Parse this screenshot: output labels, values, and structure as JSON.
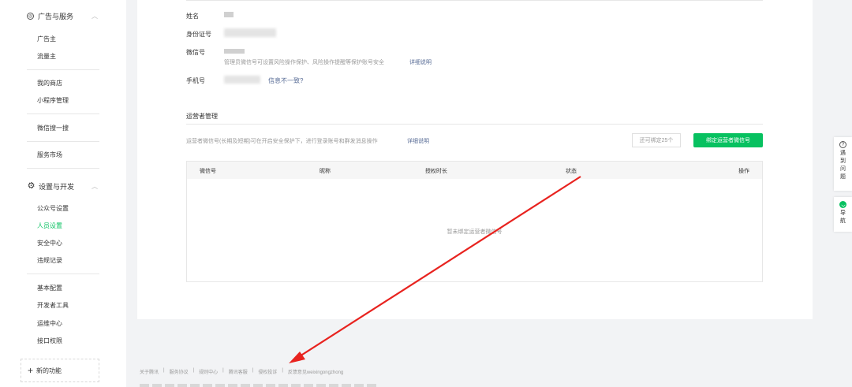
{
  "sidebar": {
    "ads_section": "广告与服务",
    "ads_items": [
      "广告主",
      "流量主"
    ],
    "shop_items": [
      "我的商店",
      "小程序管理"
    ],
    "search_item": "微信搜一搜",
    "market_item": "服务市场",
    "settings_section": "设置与开发",
    "settings_items": [
      "公众号设置",
      "人员设置",
      "安全中心",
      "违规记录"
    ],
    "dev_items": [
      "基本配置",
      "开发者工具",
      "运维中心",
      "接口权限"
    ],
    "new_feature": "新的功能",
    "active_item": "人员设置"
  },
  "admin_info": {
    "name_label": "姓名",
    "id_label": "身份证号",
    "wechat_label": "微信号",
    "wechat_desc": "管理员微信号可设置风险操作保护、风险操作提醒等保护账号安全",
    "wechat_link": "详细说明",
    "phone_label": "手机号",
    "phone_link": "信息不一致?"
  },
  "operators": {
    "title": "运营者管理",
    "desc": "运营者微信号(长期及短期)可在开启安全保护下，进行登录账号和群发消息操作",
    "desc_link": "详细说明",
    "quota": "还可绑定25个",
    "bind_button": "绑定运营者微信号",
    "columns": [
      "微信号",
      "昵称",
      "授权时长",
      "状态",
      "操作"
    ],
    "empty_text": "暂未绑定运营者微信号"
  },
  "footer": {
    "links": [
      "关于腾讯",
      "服务协议",
      "规则中心",
      "腾讯客服",
      "侵权投诉",
      "反馈意见weixingongzhong"
    ]
  },
  "floating": {
    "help_label": "遇到问题",
    "nav_label": "导航"
  },
  "colors": {
    "accent": "#07c160",
    "link": "#576b95",
    "annotation_arrow": "#e8231f"
  }
}
